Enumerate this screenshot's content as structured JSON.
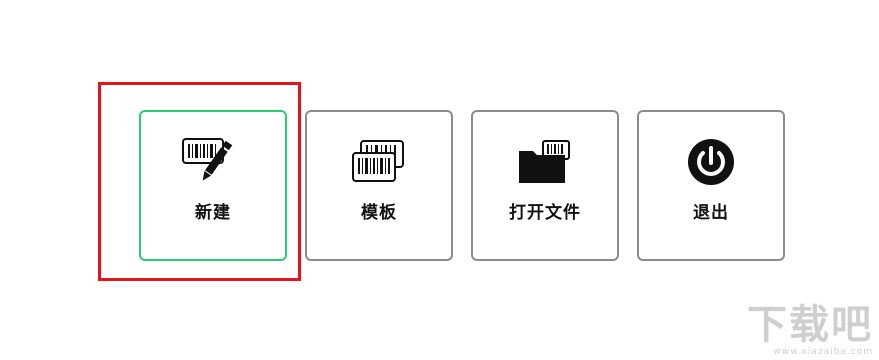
{
  "toolbar": {
    "new_label": "新建",
    "template_label": "模板",
    "open_file_label": "打开文件",
    "exit_label": "退出"
  },
  "watermark": {
    "main": "下载吧",
    "sub": "www.xiazaiba.com"
  },
  "colors": {
    "active_border": "#2ecc71",
    "default_border": "#8c8c8c",
    "highlight_box": "#e0161b",
    "icon": "#111111"
  },
  "icons": {
    "new": "barcode-pencil-icon",
    "template": "barcode-stack-icon",
    "open_file": "folder-barcode-icon",
    "exit": "power-icon"
  }
}
